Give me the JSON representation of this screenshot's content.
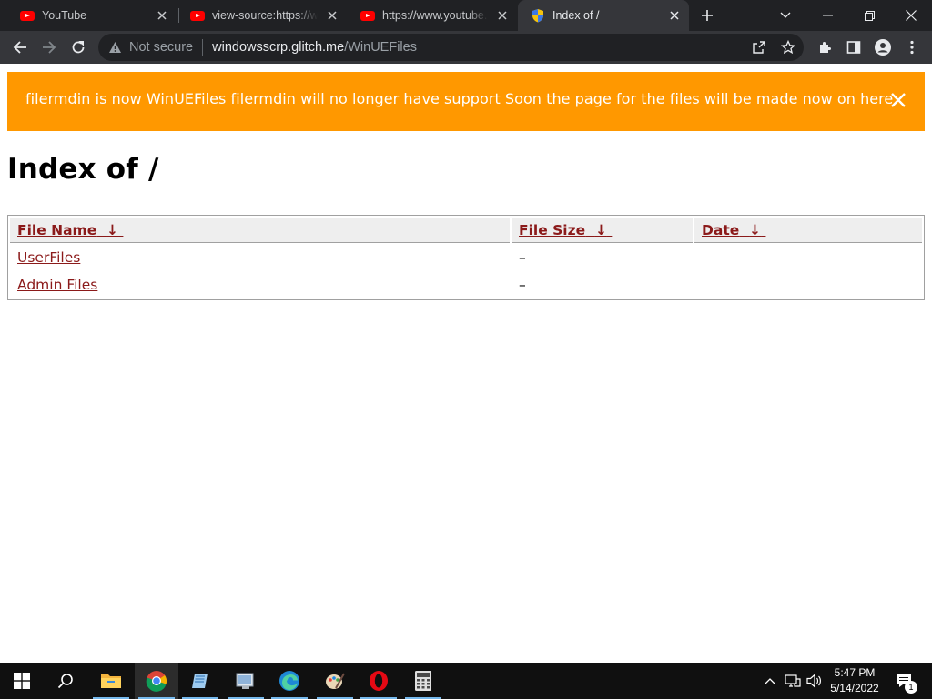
{
  "browser": {
    "tabs": [
      {
        "title": "YouTube",
        "favicon": "youtube-icon",
        "active": false
      },
      {
        "title": "view-source:https://www.youtube.com",
        "favicon": "youtube-icon",
        "active": false
      },
      {
        "title": "https://www.youtube.com",
        "favicon": "youtube-icon",
        "active": false
      },
      {
        "title": "Index of /",
        "favicon": "shield-icon",
        "active": true
      }
    ],
    "address": {
      "security_label": "Not secure",
      "host": "windowsscrp.glitch.me",
      "path": "/WinUEFiles"
    }
  },
  "page": {
    "banner": {
      "message": "filermdin is now WinUEFiles filermdin will no longer have support Soon the page for the files will be made now on here",
      "color": "#ff9800"
    },
    "heading": "Index of /",
    "table": {
      "columns": [
        {
          "label": "File Name",
          "sort_arrow": "↓"
        },
        {
          "label": "File Size",
          "sort_arrow": "↓"
        },
        {
          "label": "Date",
          "sort_arrow": "↓"
        }
      ],
      "rows": [
        {
          "name": "UserFiles",
          "size": "–",
          "date": ""
        },
        {
          "name": "Admin Files",
          "size": "–",
          "date": ""
        }
      ]
    },
    "link_color": "#8b1a1a"
  },
  "taskbar": {
    "apps": [
      "start-icon",
      "search-icon",
      "file-explorer-icon",
      "chrome-icon",
      "notepad-icon",
      "app-icon",
      "edge-icon",
      "paint-icon",
      "opera-icon",
      "calculator-icon"
    ],
    "clock": {
      "time": "5:47 PM",
      "date": "5/14/2022"
    },
    "notification_count": "1"
  }
}
